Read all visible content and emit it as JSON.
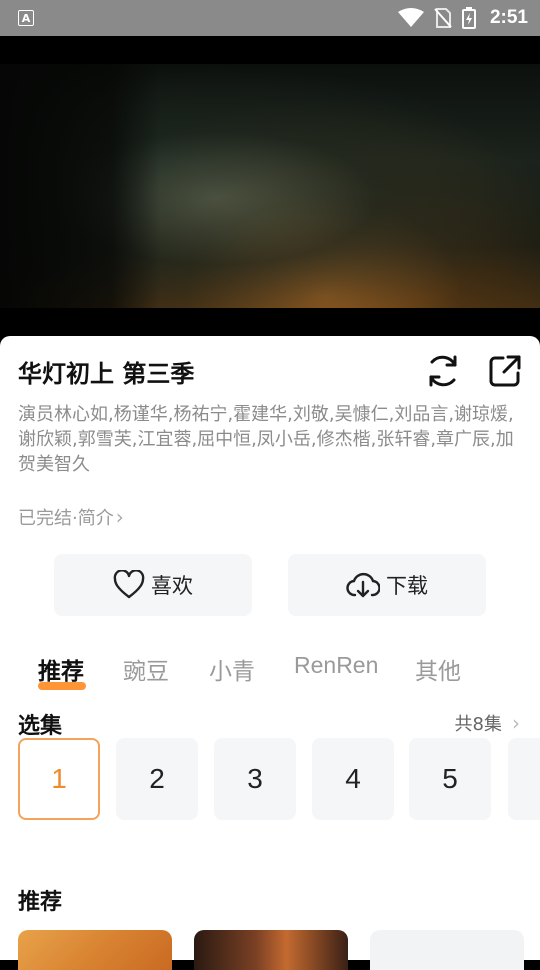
{
  "status_bar": {
    "time": "2:51"
  },
  "show": {
    "title": "华灯初上 第三季",
    "cast": "演员林心如,杨谨华,杨祐宁,霍建华,刘敬,吴慷仁,刘品言,谢琼煖,谢欣颖,郭雪芙,江宜蓉,屈中恒,凤小岳,修杰楷,张轩睿,章广辰,加贺美智久",
    "status": "已完结·简介",
    "chevron": "›"
  },
  "actions": {
    "like_label": "喜欢",
    "download_label": "下载"
  },
  "sources": [
    {
      "label": "推荐",
      "active": true
    },
    {
      "label": "豌豆",
      "active": false
    },
    {
      "label": "小青",
      "active": false
    },
    {
      "label": "RenRen",
      "active": false
    },
    {
      "label": "其他",
      "active": false
    }
  ],
  "episodes": {
    "heading": "选集",
    "count_label": "共8集",
    "items": [
      "1",
      "2",
      "3",
      "4",
      "5"
    ],
    "selected": "1"
  },
  "recommend": {
    "heading": "推荐"
  },
  "colors": {
    "accent": "#ff8a1e",
    "selected_border": "#f5a35a",
    "muted_text": "#8c8c8c",
    "button_bg": "#f5f6f8"
  }
}
